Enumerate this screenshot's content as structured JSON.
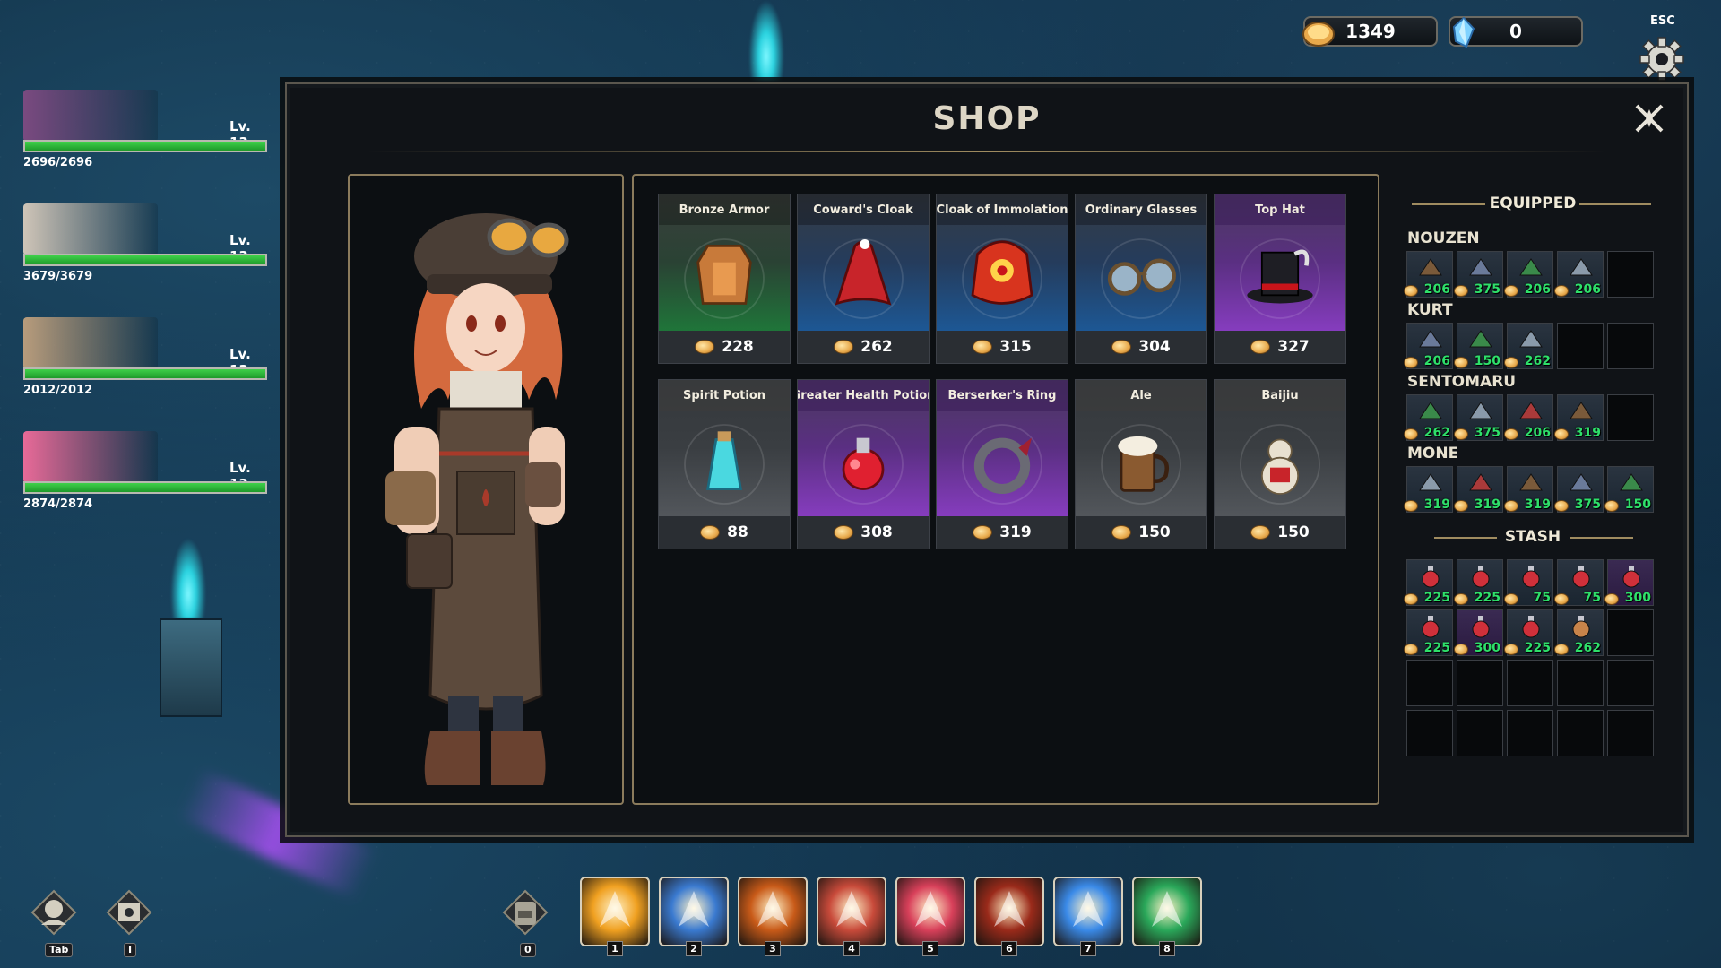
{
  "currency": {
    "gold": "1349",
    "crystals": "0"
  },
  "settings": {
    "esc_label": "ESC"
  },
  "party": [
    {
      "level": "Lv. 13",
      "hp": "2696/2696",
      "hp_fraction": 1.0,
      "portrait_color": "#7a4a80"
    },
    {
      "level": "Lv. 13",
      "hp": "3679/3679",
      "hp_fraction": 1.0,
      "portrait_color": "#cfc5b8"
    },
    {
      "level": "Lv. 13",
      "hp": "2012/2012",
      "hp_fraction": 1.0,
      "portrait_color": "#b89c7c"
    },
    {
      "level": "Lv. 13",
      "hp": "2874/2874",
      "hp_fraction": 1.0,
      "portrait_color": "#e86a98"
    }
  ],
  "shop": {
    "title": "SHOP",
    "items": [
      {
        "name": "Bronze Armor",
        "price": "228",
        "rarity": "green",
        "icon": "armor-icon"
      },
      {
        "name": "Coward's Cloak",
        "price": "262",
        "rarity": "blue",
        "icon": "cloak-icon"
      },
      {
        "name": "Cloak of Immolation",
        "price": "315",
        "rarity": "blue",
        "icon": "fire-cloak-icon"
      },
      {
        "name": "Ordinary Glasses",
        "price": "304",
        "rarity": "blue",
        "icon": "glasses-icon"
      },
      {
        "name": "Top Hat",
        "price": "327",
        "rarity": "purple",
        "icon": "top-hat-icon"
      },
      {
        "name": "Spirit Potion",
        "price": "88",
        "rarity": "gray",
        "icon": "spirit-potion-icon"
      },
      {
        "name": "Greater Health Potion",
        "price": "308",
        "rarity": "purple",
        "icon": "health-potion-icon"
      },
      {
        "name": "Berserker's Ring",
        "price": "319",
        "rarity": "purple",
        "icon": "ring-icon"
      },
      {
        "name": "Ale",
        "price": "150",
        "rarity": "gray",
        "icon": "ale-mug-icon"
      },
      {
        "name": "Baijiu",
        "price": "150",
        "rarity": "gray",
        "icon": "gourd-icon"
      }
    ]
  },
  "equipped": {
    "title": "EQUIPPED",
    "heroes": [
      {
        "name": "NOUZEN",
        "slots": [
          "206",
          "375",
          "206",
          "206",
          ""
        ]
      },
      {
        "name": "KURT",
        "slots": [
          "206",
          "150",
          "262",
          "",
          ""
        ]
      },
      {
        "name": "SENTOMARU",
        "slots": [
          "262",
          "375",
          "206",
          "319",
          ""
        ]
      },
      {
        "name": "MONE",
        "slots": [
          "319",
          "319",
          "319",
          "375",
          "150"
        ]
      }
    ]
  },
  "stash": {
    "title": "STASH",
    "slots": [
      "225",
      "225",
      "75",
      "75",
      "300",
      "225",
      "300",
      "225",
      "262",
      "",
      "",
      "",
      "",
      "",
      "",
      "",
      "",
      "",
      "",
      ""
    ]
  },
  "hud": {
    "tab_key": "Tab",
    "inventory_key": "I",
    "bag_key": "0",
    "skills": [
      {
        "key": "1",
        "icon": "lightning-slash-icon",
        "color": "#f0a020"
      },
      {
        "key": "2",
        "icon": "ice-spear-icon",
        "color": "#3a7ad0"
      },
      {
        "key": "3",
        "icon": "flame-spikes-icon",
        "color": "#c85a18"
      },
      {
        "key": "4",
        "icon": "barrel-icon",
        "color": "#c84a3a"
      },
      {
        "key": "5",
        "icon": "potion-burst-icon",
        "color": "#d8405a"
      },
      {
        "key": "6",
        "icon": "war-drum-icon",
        "color": "#9a2a1a"
      },
      {
        "key": "7",
        "icon": "ice-burst-icon",
        "color": "#3a8ae8"
      },
      {
        "key": "8",
        "icon": "nature-star-icon",
        "color": "#2aa85a"
      }
    ]
  }
}
